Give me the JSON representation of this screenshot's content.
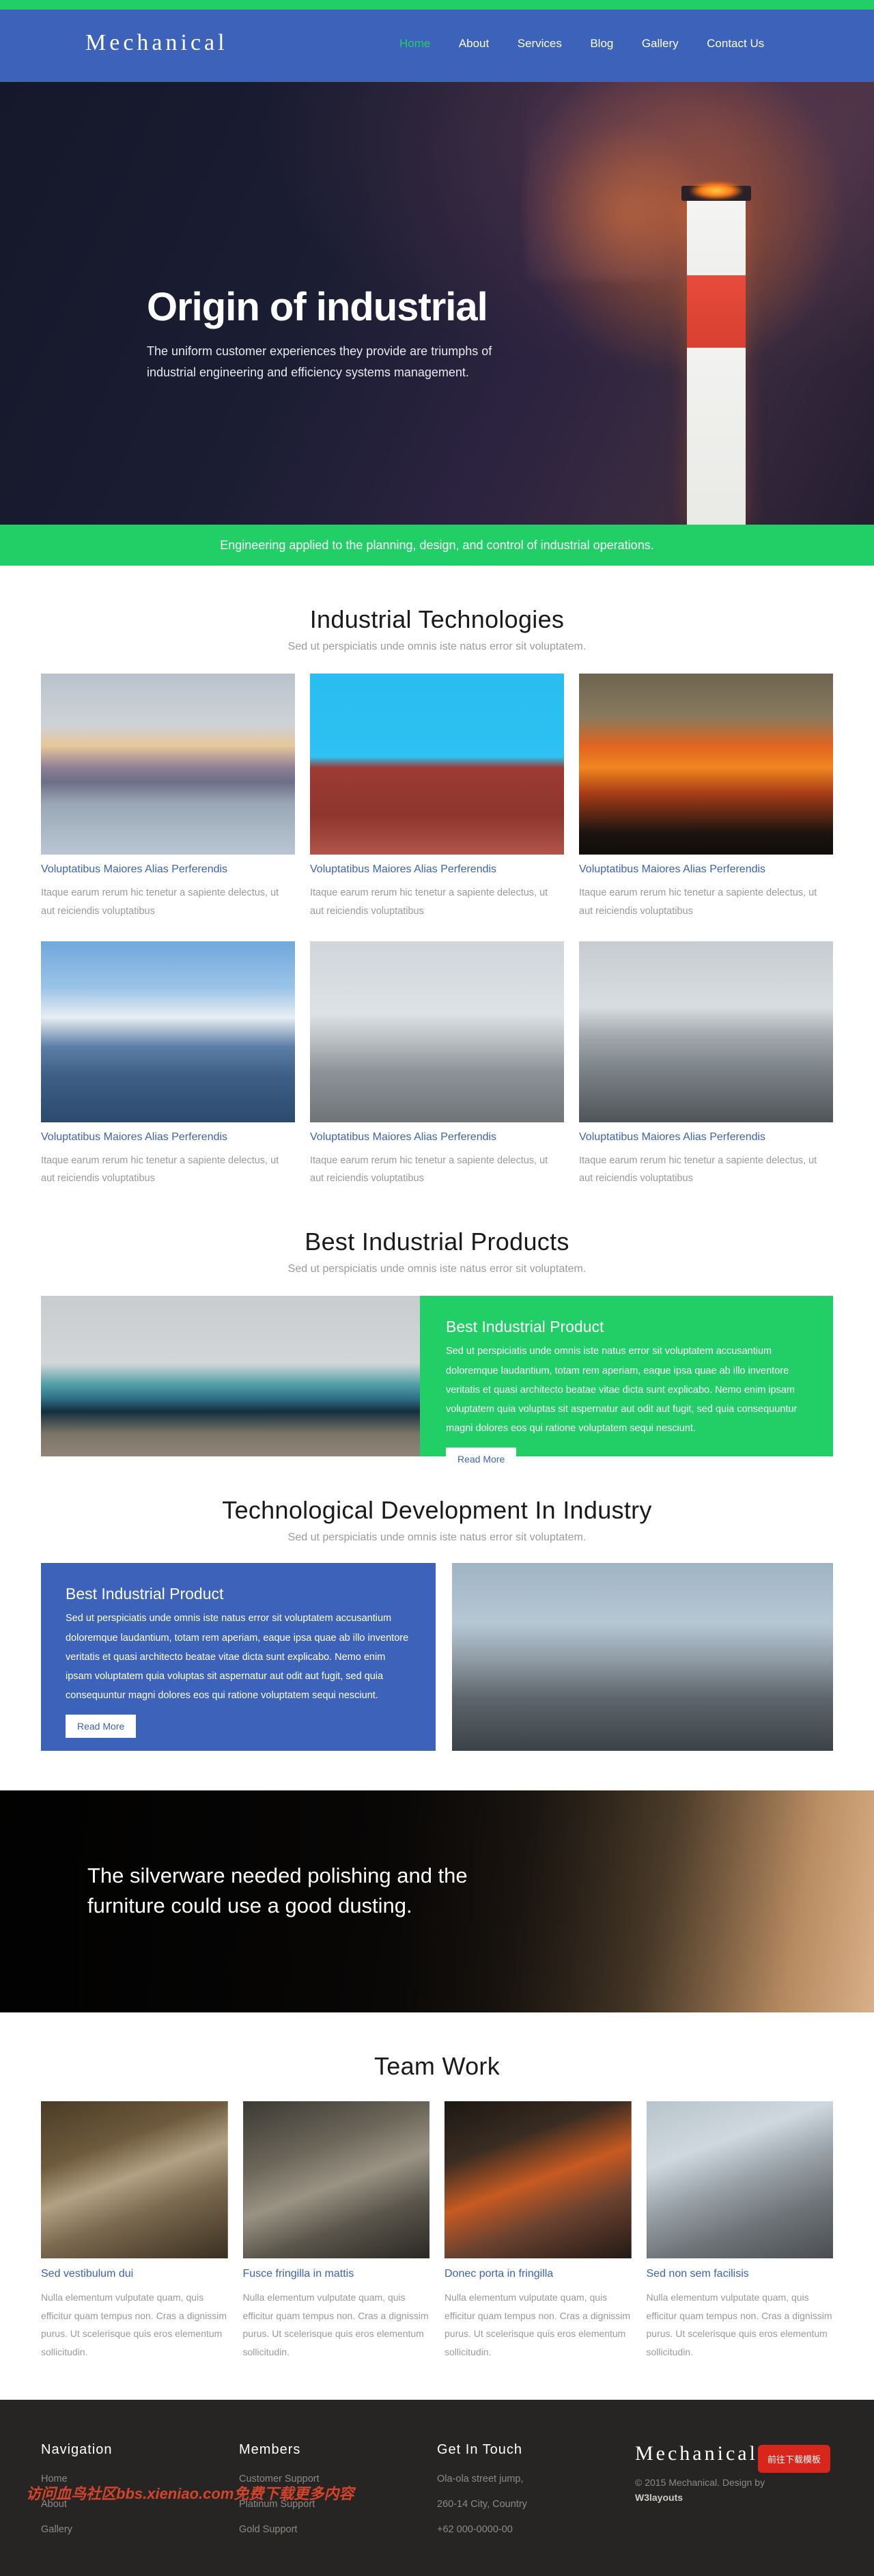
{
  "header": {
    "brand": "Mechanical",
    "nav": [
      {
        "label": "Home",
        "active": true
      },
      {
        "label": "About",
        "active": false
      },
      {
        "label": "Services",
        "active": false
      },
      {
        "label": "Blog",
        "active": false
      },
      {
        "label": "Gallery",
        "active": false
      },
      {
        "label": "Contact Us",
        "active": false
      }
    ],
    "accent_green": "#21cf66",
    "accent_blue": "#3c62b9"
  },
  "hero": {
    "title": "Origin of industrial",
    "subtitle": "The uniform customer experiences they provide are triumphs of industrial engineering and efficiency systems management."
  },
  "banner": {
    "text": "Engineering applied to the planning, design, and control of industrial operations."
  },
  "technologies": {
    "title": "Industrial Technologies",
    "subtitle": "Sed ut perspiciatis unde omnis iste natus error sit voluptatem.",
    "cards": [
      {
        "title": "Voluptatibus Maiores Alias Perferendis",
        "text": "Itaque earum rerum hic tenetur a sapiente delectus, ut aut reiciendis voluptatibus",
        "image": "industrial-river-smokestacks-photo"
      },
      {
        "title": "Voluptatibus Maiores Alias Perferendis",
        "text": "Itaque earum rerum hic tenetur a sapiente delectus, ut aut reiciendis voluptatibus",
        "image": "red-refinery-blue-sky-photo"
      },
      {
        "title": "Voluptatibus Maiores Alias Perferendis",
        "text": "Itaque earum rerum hic tenetur a sapiente delectus, ut aut reiciendis voluptatibus",
        "image": "sunset-power-pylon-photo"
      },
      {
        "title": "Voluptatibus Maiores Alias Perferendis",
        "text": "Itaque earum rerum hic tenetur a sapiente delectus, ut aut reiciendis voluptatibus",
        "image": "cooling-towers-blue-photo"
      },
      {
        "title": "Voluptatibus Maiores Alias Perferendis",
        "text": "Itaque earum rerum hic tenetur a sapiente delectus, ut aut reiciendis voluptatibus",
        "image": "grain-silos-photo"
      },
      {
        "title": "Voluptatibus Maiores Alias Perferendis",
        "text": "Itaque earum rerum hic tenetur a sapiente delectus, ut aut reiciendis voluptatibus",
        "image": "power-plant-bw-photo"
      }
    ]
  },
  "products": {
    "title": "Best Industrial Products",
    "subtitle": "Sed ut perspiciatis unde omnis iste natus error sit voluptatem.",
    "panel": {
      "heading": "Best Industrial Product",
      "body": "Sed ut perspiciatis unde omnis iste natus error sit voluptatem accusantium doloremque laudantium, totam rem aperiam, eaque ipsa quae ab illo inventore veritatis et quasi architecto beatae vitae dicta sunt explicabo. Nemo enim ipsam voluptatem quia voluptas sit aspernatur aut odit aut fugit, sed quia consequuntur magni dolores eos qui ratione voluptatem sequi nesciunt.",
      "button": "Read More",
      "image": "locomotive-on-rails-photo"
    }
  },
  "development": {
    "title": "Technological Development In Industry",
    "subtitle": "Sed ut perspiciatis unde omnis iste natus error sit voluptatem.",
    "panel": {
      "heading": "Best Industrial Product",
      "body": "Sed ut perspiciatis unde omnis iste natus error sit voluptatem accusantium doloremque laudantium, totam rem aperiam, eaque ipsa quae ab illo inventore veritatis et quasi architecto beatae vitae dicta sunt explicabo. Nemo enim ipsam voluptatem quia voluptas sit aspernatur aut odit aut fugit, sed quia consequuntur magni dolores eos qui ratione voluptatem sequi nesciunt.",
      "button": "Read More",
      "image": "refinery-cranes-photo"
    }
  },
  "quote": {
    "text": "The silverware needed polishing and the furniture could use a good dusting."
  },
  "team": {
    "title": "Team Work",
    "cards": [
      {
        "title": "Sed vestibulum dui",
        "text": "Nulla elementum vulputate quam, quis efficitur quam tempus non. Cras a dignissim purus. Ut scelerisque quis eros elementum sollicitudin.",
        "image": "worker-grinder-sparks-photo"
      },
      {
        "title": "Fusce fringilla in mattis",
        "text": "Nulla elementum vulputate quam, quis efficitur quam tempus non. Cras a dignissim purus. Ut scelerisque quis eros elementum sollicitudin.",
        "image": "worker-drill-press-photo"
      },
      {
        "title": "Donec porta in fringilla",
        "text": "Nulla elementum vulputate quam, quis efficitur quam tempus non. Cras a dignissim purus. Ut scelerisque quis eros elementum sollicitudin.",
        "image": "worker-orange-shirt-photo"
      },
      {
        "title": "Sed non sem facilisis",
        "text": "Nulla elementum vulputate quam, quis efficitur quam tempus non. Cras a dignissim purus. Ut scelerisque quis eros elementum sollicitudin.",
        "image": "worker-solar-panel-photo"
      }
    ]
  },
  "footer": {
    "navigation": {
      "heading": "Navigation",
      "items": [
        "Home",
        "About",
        "Gallery"
      ]
    },
    "members": {
      "heading": "Members",
      "items": [
        "Customer Support",
        "Platinum Support",
        "Gold Support"
      ]
    },
    "contact": {
      "heading": "Get In Touch",
      "lines": [
        "Ola-ola street jump,",
        "260-14 City, Country",
        "+62 000-0000-00"
      ]
    },
    "brand": {
      "name": "Mechanical",
      "copyright": "© 2015 Mechanical. Design by",
      "designer": "W3layouts"
    },
    "download_badge": "前往下载模板",
    "watermark": "访问血鸟社区bbs.xieniao.com免费下载更多内容"
  }
}
